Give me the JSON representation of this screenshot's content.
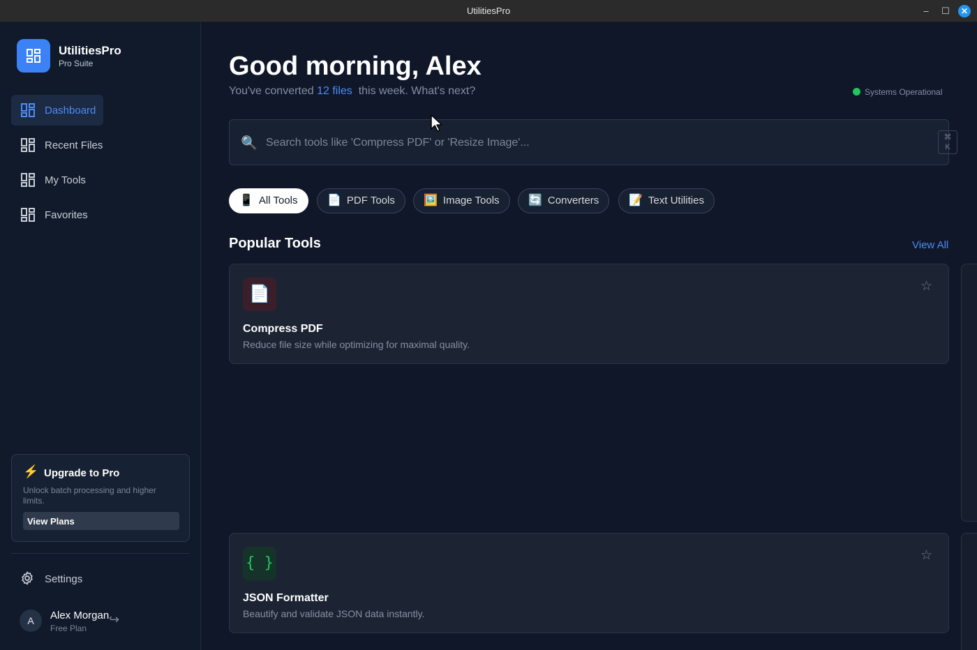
{
  "window": {
    "title": "UtilitiesPro"
  },
  "brand": {
    "name": "UtilitiesPro",
    "subtitle": "Pro Suite"
  },
  "sidebar": {
    "items": [
      {
        "label": "Dashboard",
        "active": true
      },
      {
        "label": "Recent Files",
        "active": false
      },
      {
        "label": "My Tools",
        "active": false
      },
      {
        "label": "Favorites",
        "active": false
      }
    ]
  },
  "upgrade": {
    "icon": "⚡",
    "title": "Upgrade to Pro",
    "description": "Unlock batch processing and higher limits.",
    "button": "View Plans"
  },
  "settings": {
    "label": "Settings"
  },
  "user": {
    "initial": "A",
    "name": "Alex Morgan",
    "plan": "Free Plan"
  },
  "header": {
    "greeting": "Good morning, Alex",
    "sub_prefix": "You've converted ",
    "sub_highlight": "12 files",
    "sub_suffix": "  this week. What's next?",
    "status": "Systems Operational"
  },
  "search": {
    "placeholder": "Search tools like 'Compress PDF' or 'Resize Image'...",
    "shortcut_top": "⌘",
    "shortcut_bottom": "K"
  },
  "filters": [
    {
      "emoji": "📱",
      "label": "All Tools",
      "active": true
    },
    {
      "emoji": "📄",
      "label": "PDF Tools",
      "active": false
    },
    {
      "emoji": "🖼️",
      "label": "Image Tools",
      "active": false
    },
    {
      "emoji": "🔄",
      "label": "Converters",
      "active": false
    },
    {
      "emoji": "📝",
      "label": "Text Utilities",
      "active": false
    }
  ],
  "popular": {
    "title": "Popular Tools",
    "view_all": "View All",
    "tools": [
      {
        "icon": "📄",
        "name": "Compress PDF",
        "description": "Reduce file size while optimizing for maximal quality.",
        "icon_bg": "#3a1f2a"
      },
      {
        "icon": "{ }",
        "name": "JSON Formatter",
        "description": "Beautify and validate JSON data instantly.",
        "icon_bg": "#16332a",
        "icon_color": "#22c55e"
      }
    ]
  },
  "colors": {
    "accent": "#4e8cf5",
    "brand": "#3b82f6",
    "status_ok": "#22c55e",
    "background": "#0f1729"
  }
}
